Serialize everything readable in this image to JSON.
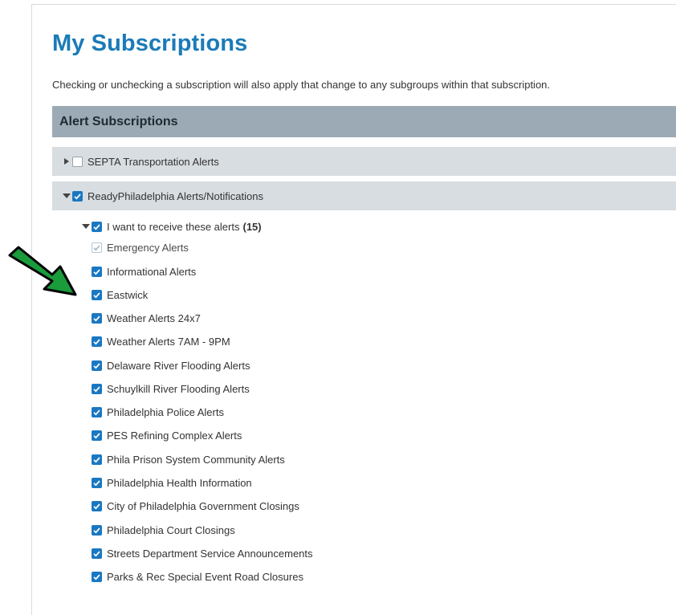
{
  "page": {
    "title": "My Subscriptions",
    "description": "Checking or unchecking a subscription will also apply that change to any subgroups within that subscription."
  },
  "section": {
    "title": "Alert Subscriptions"
  },
  "groups": [
    {
      "label": "SEPTA Transportation Alerts",
      "expanded": false,
      "checked": false
    },
    {
      "label": "ReadyPhiladelphia Alerts/Notifications",
      "expanded": true,
      "checked": true
    }
  ],
  "subgroup": {
    "label": "I want to receive these alerts",
    "count": "(15)",
    "expanded": true,
    "checked": true
  },
  "items": [
    {
      "label": "Emergency Alerts",
      "checked": true,
      "disabled": true
    },
    {
      "label": "Informational Alerts",
      "checked": true
    },
    {
      "label": "Eastwick",
      "checked": true
    },
    {
      "label": "Weather Alerts 24x7",
      "checked": true
    },
    {
      "label": "Weather Alerts 7AM - 9PM",
      "checked": true
    },
    {
      "label": "Delaware River Flooding Alerts",
      "checked": true
    },
    {
      "label": "Schuylkill River Flooding Alerts",
      "checked": true
    },
    {
      "label": "Philadelphia Police Alerts",
      "checked": true
    },
    {
      "label": "PES Refining Complex Alerts",
      "checked": true
    },
    {
      "label": "Phila Prison System Community Alerts",
      "checked": true
    },
    {
      "label": "Philadelphia Health Information",
      "checked": true
    },
    {
      "label": "City of Philadelphia Government Closings",
      "checked": true
    },
    {
      "label": "Philadelphia Court Closings",
      "checked": true
    },
    {
      "label": "Streets Department Service Announcements",
      "checked": true
    },
    {
      "label": "Parks & Rec Special Event Road Closures",
      "checked": true
    }
  ],
  "annotation": {
    "icon": "green-arrow-icon",
    "color": "#1a9b3c"
  },
  "colors": {
    "accent": "#1b7bb8",
    "checkbox": "#1a78c2",
    "header_bg": "#9baab4",
    "row_bg": "#d8dde1"
  }
}
